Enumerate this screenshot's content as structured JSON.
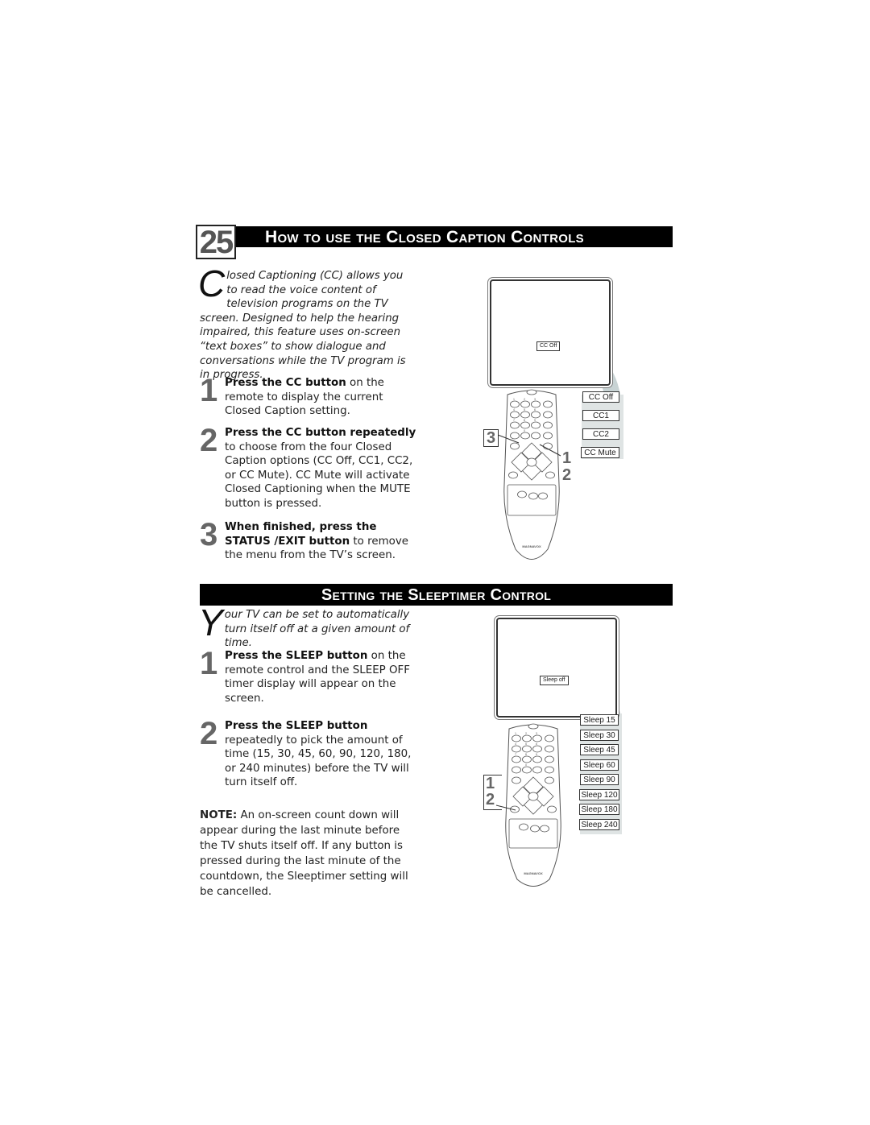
{
  "page_number": "25",
  "section1": {
    "title": "How to use the Closed Caption Controls",
    "intro_dropcap": "C",
    "intro": "losed Captioning (CC) allows you to read the voice content of television programs on the TV screen. Designed to help the hearing impaired, this feature uses on-screen “text boxes” to show dialogue and conversations while the TV program is in progress.",
    "steps": [
      {
        "num": "1",
        "bold": "Press the CC button",
        "text": " on the remote to display the current Closed Caption setting."
      },
      {
        "num": "2",
        "bold": "Press the CC button repeatedly",
        "text": " to choose from the four Closed Caption options (CC Off, CC1, CC2, or CC Mute). CC Mute will activate Closed Captioning when the MUTE button is pressed."
      },
      {
        "num": "3",
        "bold": "When finished, press the STATUS /EXIT button",
        "text": " to remove the menu from the TV’s screen."
      }
    ],
    "illustration": {
      "screen_label": "CC Off",
      "options": [
        "CC Off",
        "CC1",
        "CC2",
        "CC Mute"
      ],
      "callouts": {
        "left": "3",
        "right_top": "1",
        "right_bottom": "2"
      },
      "brand": "MAGNAVOX"
    }
  },
  "section2": {
    "title": "Setting the Sleeptimer Control",
    "intro_dropcap": "Y",
    "intro": "our TV can be set to automatically turn itself off at a given amount of time.",
    "steps": [
      {
        "num": "1",
        "bold": "Press the SLEEP button",
        "text": " on the remote control and the SLEEP OFF timer display will appear on the screen."
      },
      {
        "num": "2",
        "bold": "Press the SLEEP button",
        "text": " repeatedly to pick the amount of time (15, 30, 45, 60, 90, 120, 180, or 240 minutes) before the TV will turn itself off."
      }
    ],
    "note_label": "NOTE:",
    "note": " An on-screen count down will appear during the last minute before the TV shuts itself off. If any button is pressed during the last minute of the countdown, the Sleeptimer setting will be cancelled.",
    "illustration": {
      "screen_label": "Sleep off",
      "options": [
        "Sleep 15",
        "Sleep 30",
        "Sleep 45",
        "Sleep 60",
        "Sleep 90",
        "Sleep 120",
        "Sleep 180",
        "Sleep 240"
      ],
      "callouts": {
        "top": "1",
        "bottom": "2"
      },
      "brand": "MAGNAVOX"
    }
  },
  "remote_keys": [
    "1",
    "2",
    "3",
    "4",
    "5",
    "6",
    "7",
    "8",
    "9",
    "0"
  ]
}
